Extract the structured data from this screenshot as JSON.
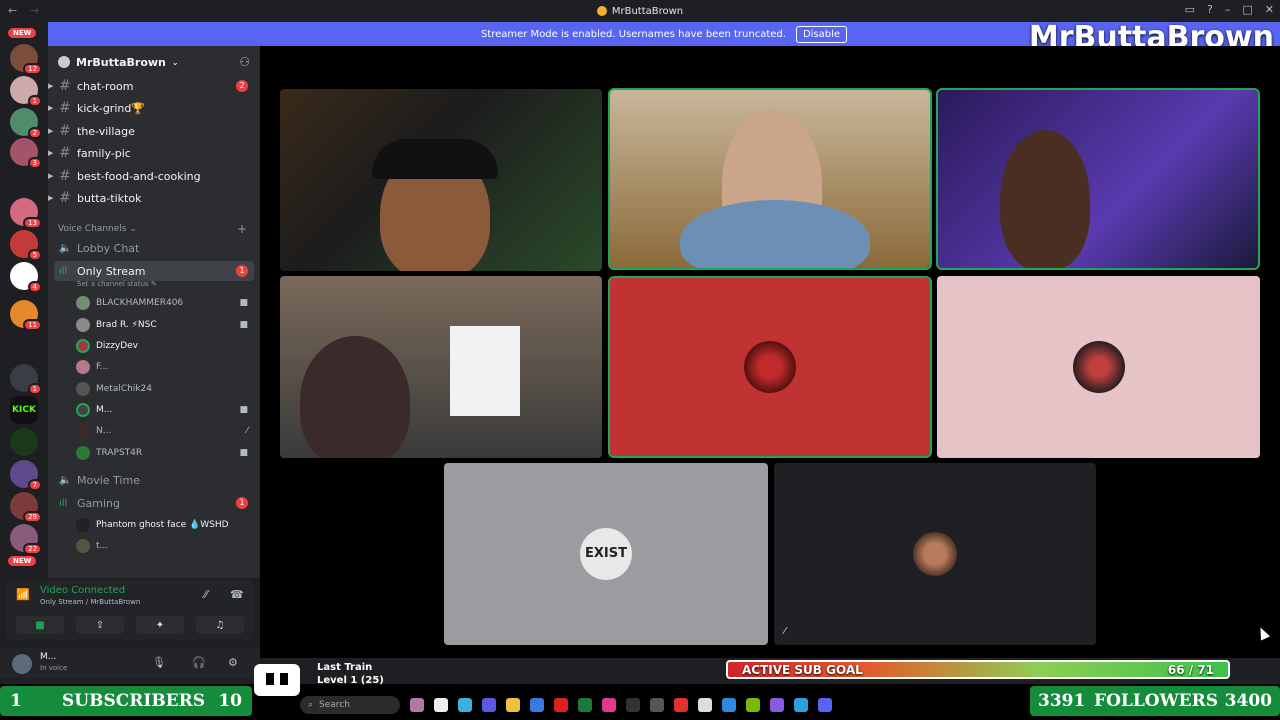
{
  "window": {
    "title": "MrButtaBrown"
  },
  "banner": {
    "text": "Streamer Mode is enabled. Usernames have been truncated.",
    "button": "Disable"
  },
  "overlay": {
    "brand": "MrButtaBrown"
  },
  "guild_badges": [
    "NEW",
    "12",
    "1",
    "2",
    "3",
    "13",
    "5",
    "4",
    "11",
    "1",
    "7",
    "29",
    "22",
    "NEW"
  ],
  "server": {
    "name": "MrButtaBrown"
  },
  "text_channels": [
    {
      "name": "chat-room",
      "badge": "2"
    },
    {
      "name": "kick-grind🏆",
      "badge": ""
    },
    {
      "name": "the-village",
      "badge": ""
    },
    {
      "name": "family-pic",
      "badge": ""
    },
    {
      "name": "best-food-and-cooking",
      "badge": ""
    },
    {
      "name": "butta-tiktok",
      "badge": ""
    }
  ],
  "voice_category": "Voice Channels",
  "voice_channels": {
    "lobby": "Lobby Chat",
    "only_stream": {
      "name": "Only Stream",
      "badge": "1",
      "status": "Set a channel status ✎"
    },
    "users": [
      "BLACKHAMMER406",
      "Brad R. ⚡NSC",
      "DizzyDev",
      "F...",
      "MetalChik24",
      "M...",
      "N...",
      "TRAPST4R"
    ],
    "movie_time": "Movie Time",
    "gaming": {
      "name": "Gaming",
      "badge": "1"
    },
    "gaming_users": [
      "Phantom ghost face 💧WSHD",
      "t..."
    ]
  },
  "voice_panel": {
    "title": "Video Connected",
    "sub": "Only Stream / MrButtaBrown"
  },
  "user_panel": {
    "name": "M...",
    "status": "In voice"
  },
  "sub_goal": {
    "label": "ACTIVE SUB GOAL",
    "count": "66 / 71",
    "current": 66,
    "target": 71
  },
  "subscribers": {
    "left": "1",
    "label": "SUBSCRIBERS",
    "right": "10"
  },
  "followers": {
    "left": "3391",
    "label": "FOLLOWERS",
    "right": "3400"
  },
  "music": {
    "line1": "Last Train",
    "line2": "Level 1 (25)"
  },
  "taskbar": {
    "search": "Search"
  },
  "tiles": {
    "exist_label": "EXIST"
  },
  "colors": {
    "blurple": "#5865f2",
    "green": "#23a559",
    "red": "#f23f43"
  }
}
